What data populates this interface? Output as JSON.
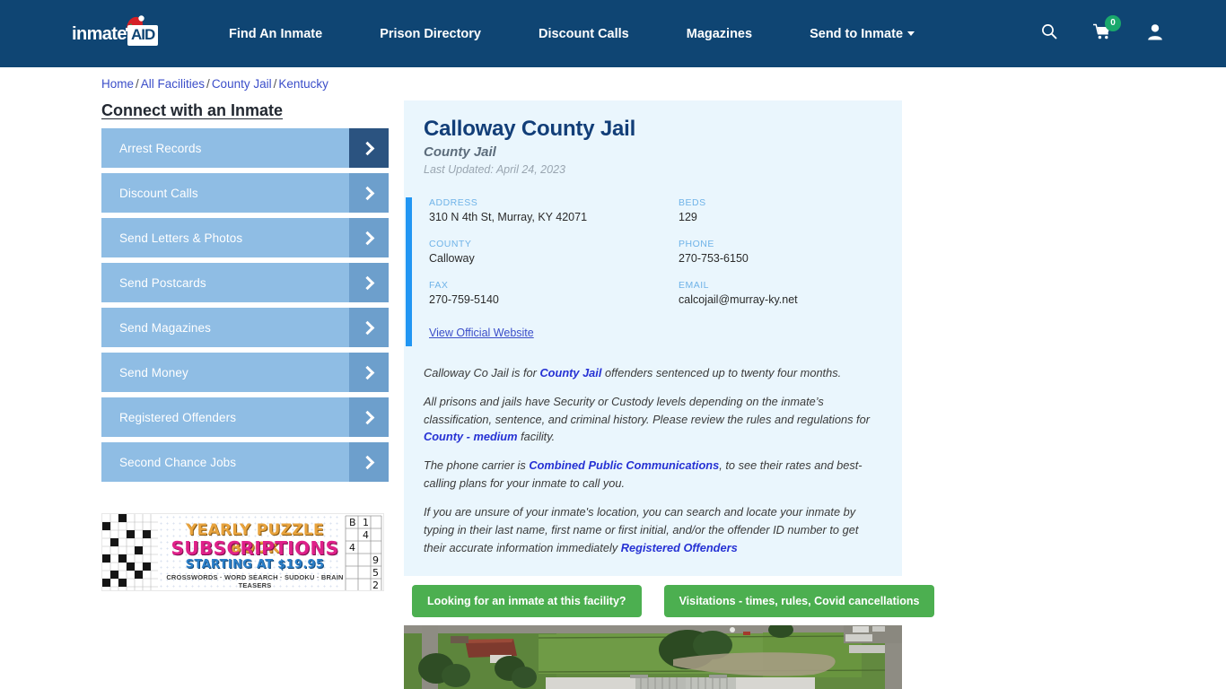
{
  "header": {
    "logo_text": "inmate",
    "logo_badge": "AID",
    "logo_icon": "santa-hat-icon",
    "nav": [
      {
        "label": "Find An Inmate"
      },
      {
        "label": "Prison Directory"
      },
      {
        "label": "Discount Calls"
      },
      {
        "label": "Magazines"
      },
      {
        "label": "Send to Inmate",
        "has_dropdown": true
      }
    ],
    "icons": {
      "search": "search-icon",
      "cart": "shopping-cart-icon",
      "cart_count": "0",
      "account": "user-account-icon"
    },
    "bg_color": "#0f4573",
    "badge_color": "#1aa86c"
  },
  "breadcrumb": {
    "items": [
      "Home",
      "All Facilities",
      "County Jail",
      "Kentucky"
    ],
    "separator": "/"
  },
  "sidebar": {
    "title": "Connect with an Inmate",
    "items": [
      {
        "label": "Arrest Records",
        "active": true
      },
      {
        "label": "Discount Calls",
        "active": false
      },
      {
        "label": "Send Letters & Photos",
        "active": false
      },
      {
        "label": "Send Postcards",
        "active": false
      },
      {
        "label": "Send Magazines",
        "active": false
      },
      {
        "label": "Send Money",
        "active": false
      },
      {
        "label": "Registered Offenders",
        "active": false
      },
      {
        "label": "Second Chance Jobs",
        "active": false
      }
    ],
    "item_color": "#8fbde4",
    "arrow_color": "#6d9fcc",
    "arrow_active_color": "#2b5380"
  },
  "ad": {
    "line1": "YEARLY PUZZLE BOOK",
    "line2": "SUBSCRIPTIONS",
    "line3": "STARTING AT $19.95",
    "line4": "CROSSWORDS · WORD SEARCH · SUDOKU · BRAIN TEASERS",
    "color1": "#e8a33d",
    "color2": "#e0218a",
    "color3": "#2b7fc9"
  },
  "facility": {
    "name": "Calloway County Jail",
    "type": "County Jail",
    "last_updated": "Last Updated: April 24, 2023",
    "fields": [
      {
        "label": "ADDRESS",
        "value": "310 N 4th St, Murray, KY 42071"
      },
      {
        "label": "BEDS",
        "value": "129"
      },
      {
        "label": "COUNTY",
        "value": "Calloway"
      },
      {
        "label": "PHONE",
        "value": "270-753-6150"
      },
      {
        "label": "FAX",
        "value": "270-759-5140"
      },
      {
        "label": "EMAIL",
        "value": "calcojail@murray-ky.net"
      }
    ],
    "official_website_link": "View Official Website",
    "accent_color": "#2196f3",
    "card_bg": "#eaf6fd"
  },
  "description": {
    "p1_a": "Calloway Co Jail is for ",
    "p1_link": "County Jail",
    "p1_b": " offenders sentenced up to twenty four months.",
    "p2_a": "All prisons and jails have Security or Custody levels depending on the inmate’s classification, sentence, and criminal history. Please review the rules and regulations for ",
    "p2_link": "County - medium",
    "p2_b": " facility.",
    "p3_a": "The phone carrier is ",
    "p3_link": "Combined Public Communications",
    "p3_b": ", to see their rates and best-calling plans for your inmate to call you.",
    "p4_a": "If you are unsure of your inmate's location, you can search and locate your inmate by typing in their last name, first name or first initial, and/or the offender ID number to get their accurate information immediately ",
    "p4_link": "Registered Offenders",
    "p4_b": ""
  },
  "actions": {
    "find_inmate": "Looking for an inmate at this facility?",
    "visitations": "Visitations - times, rules, Covid cancellations",
    "button_color": "#4caf50"
  },
  "satellite": {
    "alt": "aerial-view-of-calloway-county-jail"
  }
}
